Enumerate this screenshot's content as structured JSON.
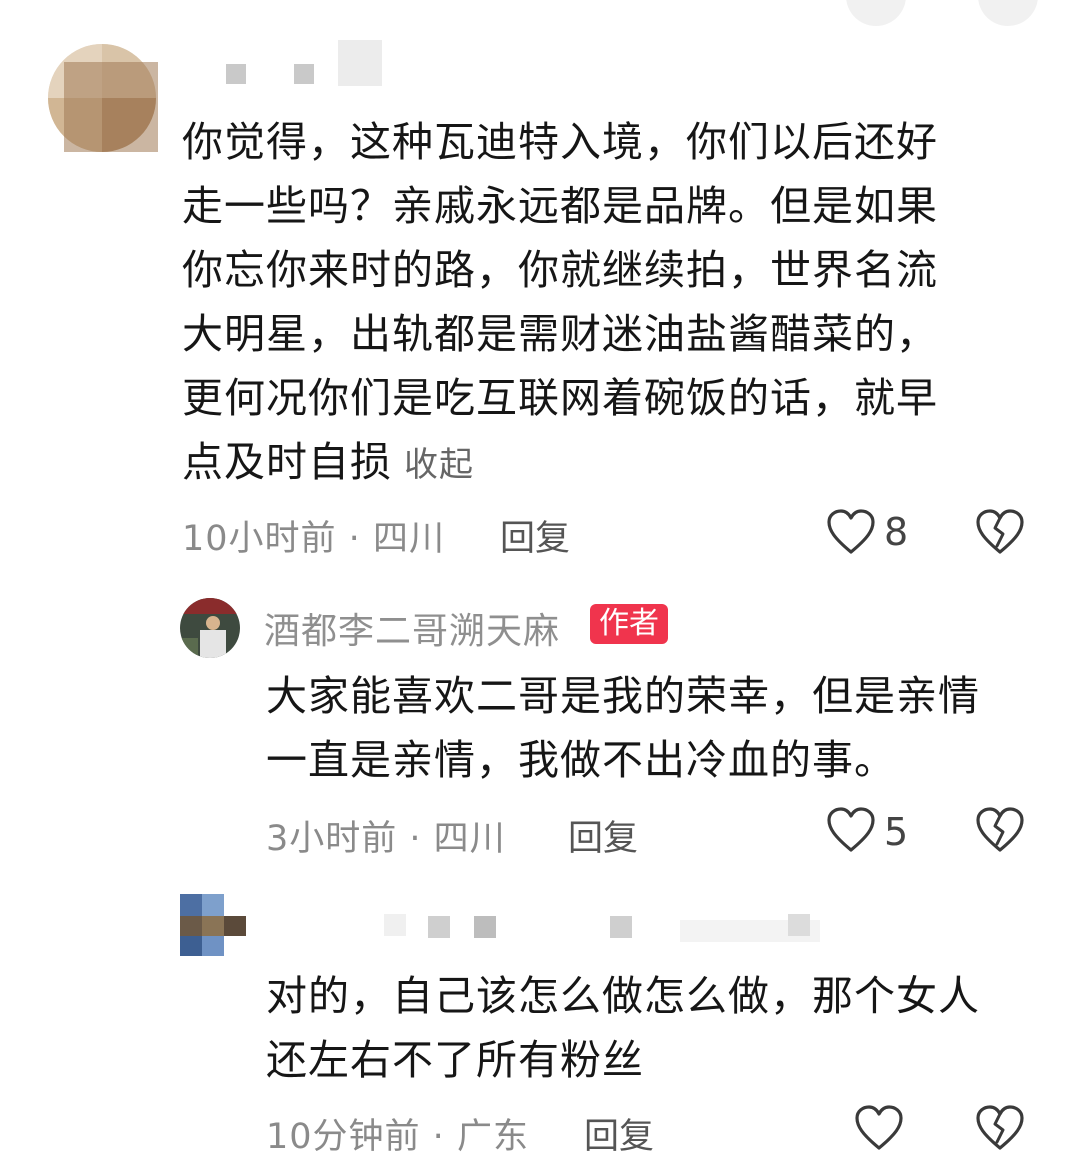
{
  "colors": {
    "author_badge": "#f0344d",
    "meta_text": "#8a8a8a",
    "body_text": "#161616"
  },
  "comments": [
    {
      "author": "",
      "text": "你觉得，这种瓦迪特入境，你们以后还好走一些吗？亲戚永远都是品牌。但是如果你忘你来时的路，你就继续拍，世界名流大明星，出轨都是需财迷油盐酱醋菜的，更何况你们是吃互联网着碗饭的话，就早点及时自损",
      "text_lines": [
        "你觉得，这种瓦迪特入境，你们以后还好",
        "走一些吗？亲戚永远都是品牌。但是如果",
        "你忘你来时的路，你就继续拍，世界名流",
        "大明星，出轨都是需财迷油盐酱醋菜的，",
        "更何况你们是吃互联网着碗饭的话，就早",
        "点及时自损"
      ],
      "collapse_label": "收起",
      "time": "10小时前",
      "location": "四川",
      "reply_label": "回复",
      "likes": "8",
      "like_icon": "heart-outline-icon",
      "dislike_icon": "broken-heart-icon"
    },
    {
      "author": "酒都李二哥溯天麻",
      "badge": "作者",
      "text_lines": [
        "大家能喜欢二哥是我的荣幸，但是亲情",
        "一直是亲情，我做不出冷血的事。"
      ],
      "time": "3小时前",
      "location": "四川",
      "reply_label": "回复",
      "likes": "5",
      "like_icon": "heart-outline-icon",
      "dislike_icon": "broken-heart-icon"
    },
    {
      "author": "",
      "text_lines": [
        "对的，自己该怎么做怎么做，那个女人",
        "还左右不了所有粉丝"
      ],
      "time": "10分钟前",
      "location": "广东",
      "reply_label": "回复",
      "likes": "",
      "like_icon": "heart-outline-icon",
      "dislike_icon": "broken-heart-icon"
    }
  ],
  "separator": " · "
}
